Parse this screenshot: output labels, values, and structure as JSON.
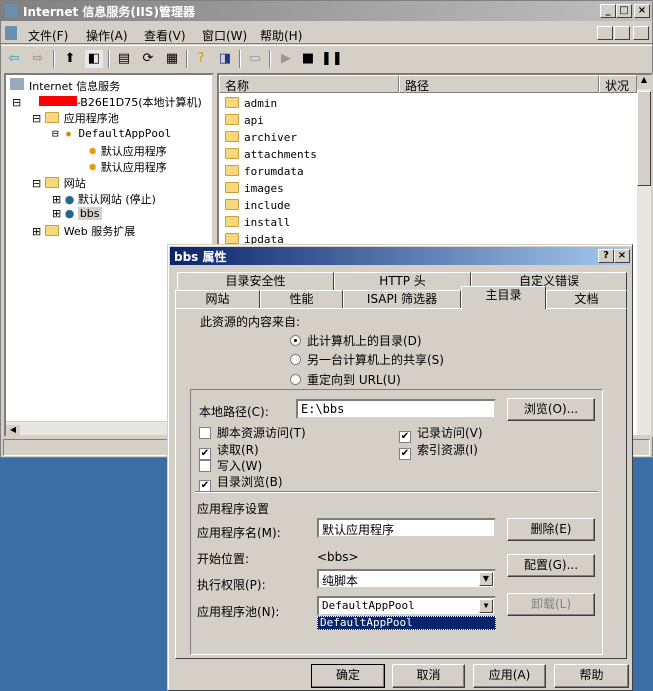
{
  "window": {
    "title": "Internet 信息服务(IIS)管理器",
    "min": "_",
    "max": "□",
    "close": "×"
  },
  "menu": [
    "文件(F)",
    "操作(A)",
    "查看(V)",
    "窗口(W)",
    "帮助(H)"
  ],
  "tree": {
    "root": "Internet 信息服务",
    "computer": "-B26E1D75(本地计算机)",
    "app_pools": "应用程序池",
    "default_pool": "DefaultAppPool",
    "app1": "默认应用程序",
    "app2": "默认应用程序",
    "sites": "网站",
    "default_site": "默认网站 (停止)",
    "bbs": "bbs",
    "web_ext": "Web 服务扩展"
  },
  "list": {
    "headers": [
      "名称",
      "路径",
      "状况"
    ],
    "items": [
      "admin",
      "api",
      "archiver",
      "attachments",
      "forumdata",
      "images",
      "include",
      "install",
      "ipdata"
    ]
  },
  "dialog": {
    "title": "bbs 属性",
    "help": "?",
    "close": "×",
    "tabs_row1": [
      "目录安全性",
      "HTTP 头",
      "自定义错误"
    ],
    "tabs_row2": [
      "网站",
      "性能",
      "ISAPI 筛选器",
      "主目录",
      "文档"
    ],
    "source_label": "此资源的内容来自:",
    "radios": [
      "此计算机上的目录(D)",
      "另一台计算机上的共享(S)",
      "重定向到 URL(U)"
    ],
    "local_path_label": "本地路径(C):",
    "local_path": "E:\\bbs",
    "browse": "浏览(O)...",
    "checks_left": [
      {
        "label": "脚本资源访问(T)",
        "checked": false
      },
      {
        "label": "读取(R)",
        "checked": true
      },
      {
        "label": "写入(W)",
        "checked": false
      },
      {
        "label": "目录浏览(B)",
        "checked": true
      }
    ],
    "checks_right": [
      {
        "label": "记录访问(V)",
        "checked": true
      },
      {
        "label": "索引资源(I)",
        "checked": true
      }
    ],
    "app_settings": "应用程序设置",
    "app_name_label": "应用程序名(M):",
    "app_name": "默认应用程序",
    "remove": "删除(E)",
    "start_label": "开始位置:",
    "start_value": "<bbs>",
    "config": "配置(G)...",
    "exec_label": "执行权限(P):",
    "exec_value": "纯脚本",
    "unload": "卸载(L)",
    "pool_label": "应用程序池(N):",
    "pool_value": "DefaultAppPool",
    "pool_option": "DefaultAppPool",
    "ok": "确定",
    "cancel": "取消",
    "apply": "应用(A)",
    "help_btn": "帮助"
  }
}
